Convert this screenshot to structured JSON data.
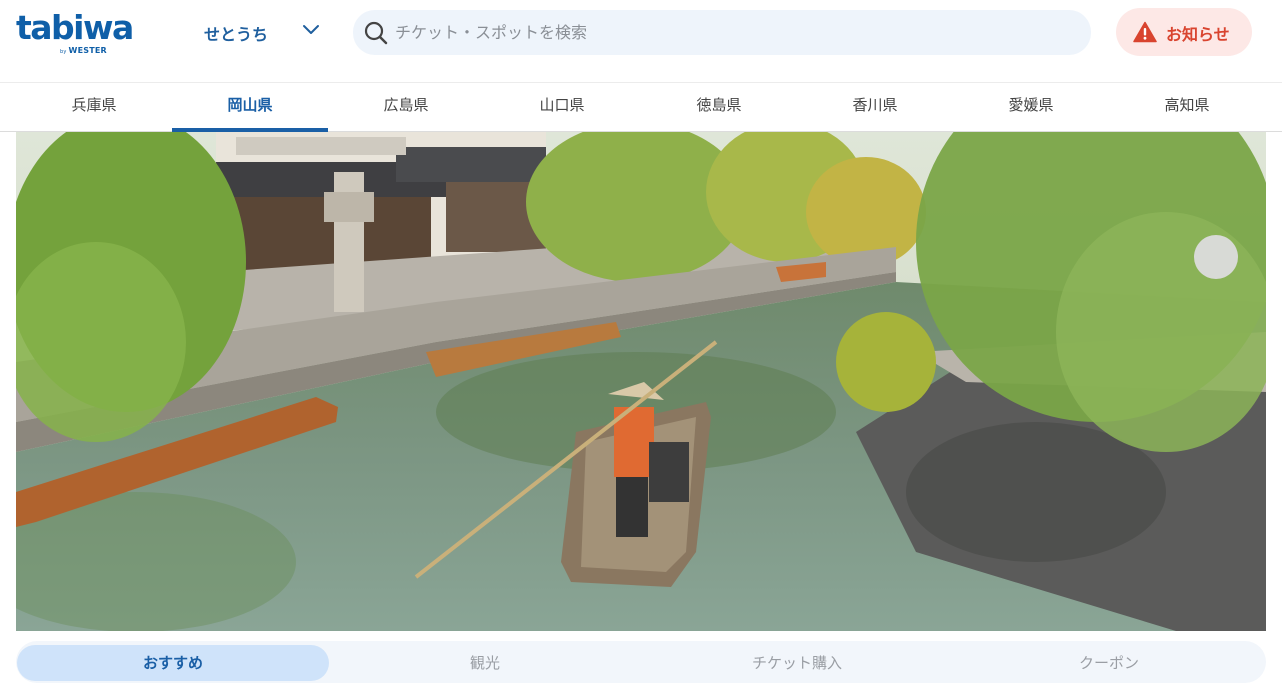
{
  "header": {
    "logo_text": "tabiwa",
    "logo_by": "by",
    "logo_brand": "WESTER",
    "region_label": "せとうち",
    "search_placeholder": "チケット・スポットを検索",
    "notice_label": "お知らせ"
  },
  "prefecture_tabs": [
    {
      "label": "兵庫県",
      "active": false
    },
    {
      "label": "岡山県",
      "active": true
    },
    {
      "label": "広島県",
      "active": false
    },
    {
      "label": "山口県",
      "active": false
    },
    {
      "label": "徳島県",
      "active": false
    },
    {
      "label": "香川県",
      "active": false
    },
    {
      "label": "愛媛県",
      "active": false
    },
    {
      "label": "高知県",
      "active": false
    }
  ],
  "content_tabs": [
    {
      "label": "おすすめ",
      "active": true
    },
    {
      "label": "観光",
      "active": false
    },
    {
      "label": "チケット購入",
      "active": false
    },
    {
      "label": "クーポン",
      "active": false
    }
  ],
  "colors": {
    "brand_blue": "#1a5fa6",
    "notice_red": "#d9442f",
    "search_bg": "#eef4fb"
  }
}
